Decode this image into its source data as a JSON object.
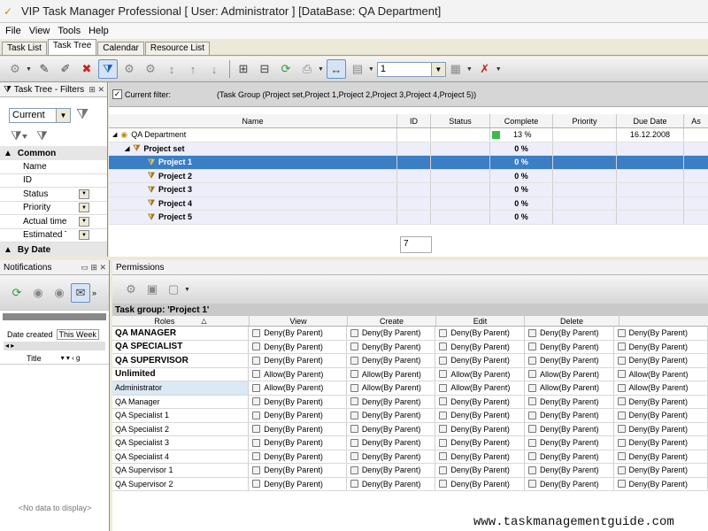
{
  "title": "VIP Task Manager Professional [ User: Administrator ] [DataBase: QA Department]",
  "menu": [
    "File",
    "View",
    "Tools",
    "Help"
  ],
  "tabs": [
    "Task List",
    "Task Tree",
    "Calendar",
    "Resource List"
  ],
  "toolbar": {
    "page_value": "1"
  },
  "filters_pane": {
    "title": "Task Tree - Filters",
    "current": "Current",
    "category_common": "Common",
    "fields": [
      "Name",
      "ID",
      "Status",
      "Priority",
      "Actual time",
      "Estimated Ti"
    ],
    "category_date": "By Date"
  },
  "current_filter": {
    "label": "Current filter:",
    "value": "(Task Group  (Project set,Project 1,Project 2,Project 3,Project 4,Project 5))"
  },
  "grid": {
    "columns": [
      "Name",
      "ID",
      "Status",
      "Complete",
      "Priority",
      "Due Date",
      "As"
    ],
    "rows": [
      {
        "name": "QA Department",
        "complete": "13 %",
        "due": "16.12.2008"
      },
      {
        "name": "Project set",
        "complete": "0 %",
        "due": ""
      },
      {
        "name": "Project 1",
        "complete": "0 %",
        "due": ""
      },
      {
        "name": "Project 2",
        "complete": "0 %",
        "due": ""
      },
      {
        "name": "Project 3",
        "complete": "0 %",
        "due": ""
      },
      {
        "name": "Project 4",
        "complete": "0 %",
        "due": ""
      },
      {
        "name": "Project 5",
        "complete": "0 %",
        "due": ""
      }
    ],
    "page": "7"
  },
  "notifications": {
    "title": "Notifications",
    "date_label": "Date created",
    "date_value": "This Week",
    "title_col": "Title",
    "empty": "<No data to display>"
  },
  "permissions": {
    "title": "Permissions",
    "task_group": "Task group: 'Project 1'",
    "columns": [
      "Roles",
      "View",
      "Create",
      "Edit",
      "Delete"
    ],
    "rows": [
      {
        "role": "QA MANAGER",
        "v": [
          "Deny(By Parent)",
          "Deny(By Parent)",
          "Deny(By Parent)",
          "Deny(By Parent)",
          "Deny(By Parent)"
        ]
      },
      {
        "role": "QA SPECIALIST",
        "v": [
          "Deny(By Parent)",
          "Deny(By Parent)",
          "Deny(By Parent)",
          "Deny(By Parent)",
          "Deny(By Parent)"
        ]
      },
      {
        "role": "QA SUPERVISOR",
        "v": [
          "Deny(By Parent)",
          "Deny(By Parent)",
          "Deny(By Parent)",
          "Deny(By Parent)",
          "Deny(By Parent)"
        ]
      },
      {
        "role": "Unlimited",
        "v": [
          "Allow(By Parent)",
          "Allow(By Parent)",
          "Allow(By Parent)",
          "Allow(By Parent)",
          "Allow(By Parent)"
        ]
      },
      {
        "role": "Administrator",
        "v": [
          "Allow(By Parent)",
          "Allow(By Parent)",
          "Allow(By Parent)",
          "Allow(By Parent)",
          "Allow(By Parent)"
        ]
      },
      {
        "role": "QA Manager",
        "v": [
          "Deny(By Parent)",
          "Deny(By Parent)",
          "Deny(By Parent)",
          "Deny(By Parent)",
          "Deny(By Parent)"
        ]
      },
      {
        "role": "QA Specialist 1",
        "v": [
          "Deny(By Parent)",
          "Deny(By Parent)",
          "Deny(By Parent)",
          "Deny(By Parent)",
          "Deny(By Parent)"
        ]
      },
      {
        "role": "QA Specialist 2",
        "v": [
          "Deny(By Parent)",
          "Deny(By Parent)",
          "Deny(By Parent)",
          "Deny(By Parent)",
          "Deny(By Parent)"
        ]
      },
      {
        "role": "QA Specialist 3",
        "v": [
          "Deny(By Parent)",
          "Deny(By Parent)",
          "Deny(By Parent)",
          "Deny(By Parent)",
          "Deny(By Parent)"
        ]
      },
      {
        "role": "QA Specialist 4",
        "v": [
          "Deny(By Parent)",
          "Deny(By Parent)",
          "Deny(By Parent)",
          "Deny(By Parent)",
          "Deny(By Parent)"
        ]
      },
      {
        "role": "QA Supervisor 1",
        "v": [
          "Deny(By Parent)",
          "Deny(By Parent)",
          "Deny(By Parent)",
          "Deny(By Parent)",
          "Deny(By Parent)"
        ]
      },
      {
        "role": "QA Supervisor 2",
        "v": [
          "Deny(By Parent)",
          "Deny(By Parent)",
          "Deny(By Parent)",
          "Deny(By Parent)",
          "Deny(By Parent)"
        ]
      }
    ]
  },
  "watermark": "www.taskmanagementguide.com"
}
